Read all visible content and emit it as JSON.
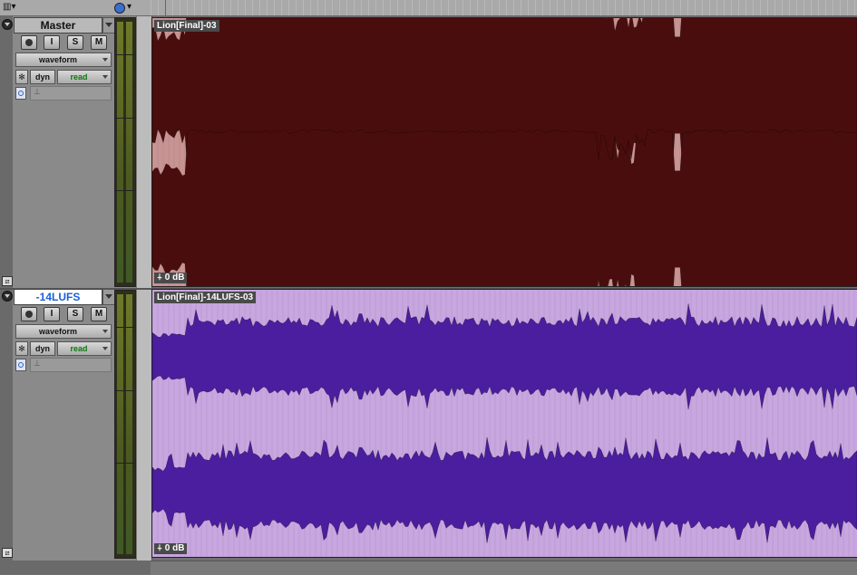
{
  "colors": {
    "track1_clip_bg": "#c89393",
    "track1_waveform": "#4a0d0d",
    "track2_clip_bg": "#c8a6e0",
    "track2_waveform": "#4a1e9e",
    "playhead": "#dd3333",
    "automation_read": "#0a7a0a",
    "name_blue": "#1a5fd6"
  },
  "toolbar": {
    "view_icon": "grid-menu-icon",
    "clock_icon": "clock-icon"
  },
  "tracks": [
    {
      "name": "Master",
      "buttons": {
        "input": "I",
        "solo": "S",
        "mute": "M"
      },
      "view": "waveform",
      "dyn": "dyn",
      "automation": "read",
      "clip": {
        "name": "Lion[Final]-03",
        "gain": "0 dB"
      }
    },
    {
      "name": "-14LUFS",
      "buttons": {
        "input": "I",
        "solo": "S",
        "mute": "M"
      },
      "view": "waveform",
      "dyn": "dyn",
      "automation": "read",
      "clip": {
        "name": "Lion[Final]-14LUFS-03",
        "gain": "0 dB"
      }
    }
  ]
}
